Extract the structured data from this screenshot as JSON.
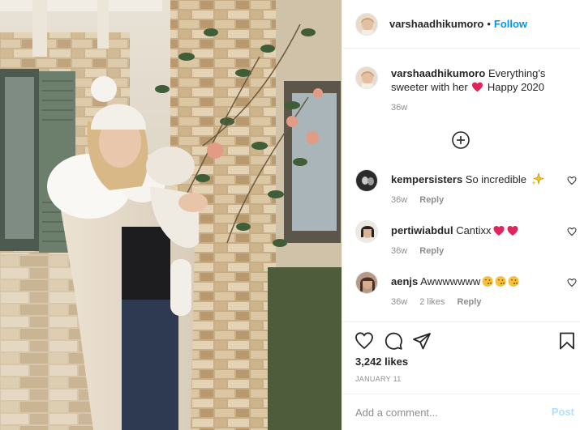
{
  "colors": {
    "accent": "#0095f6",
    "muted": "#8e8e8e",
    "text": "#262626",
    "heart": "#ed4956",
    "post_disabled": "#b2dffc"
  },
  "header": {
    "username": "varshaadhikumoro",
    "separator": "•",
    "follow_label": "Follow"
  },
  "caption": {
    "username": "varshaadhikumoro",
    "text_before_emoji": "Everything's sweeter with her",
    "emoji": "red-heart",
    "text_after_emoji": "Happy 2020",
    "time": "36w"
  },
  "load_more_icon": "plus-circle-icon",
  "comments": [
    {
      "username": "kempersisters",
      "text": "So incredible",
      "emoji": "sparkles",
      "time": "36w",
      "likes": "",
      "reply_label": "Reply"
    },
    {
      "username": "pertiwiabdul",
      "text": "Cantixx",
      "emoji": "two-red-hearts",
      "time": "36w",
      "likes": "",
      "reply_label": "Reply"
    },
    {
      "username": "aenjs",
      "text": "Awwwwwww",
      "emoji": "three-blowing-kiss-faces",
      "time": "36w",
      "likes": "2 likes",
      "reply_label": "Reply"
    }
  ],
  "actions": {
    "like_icon": "heart-icon",
    "comment_icon": "comment-icon",
    "share_icon": "paper-plane-icon",
    "save_icon": "bookmark-icon"
  },
  "likes_count": "3,242 likes",
  "date": "JANUARY 11",
  "add_comment": {
    "placeholder": "Add a comment...",
    "post_label": "Post"
  }
}
